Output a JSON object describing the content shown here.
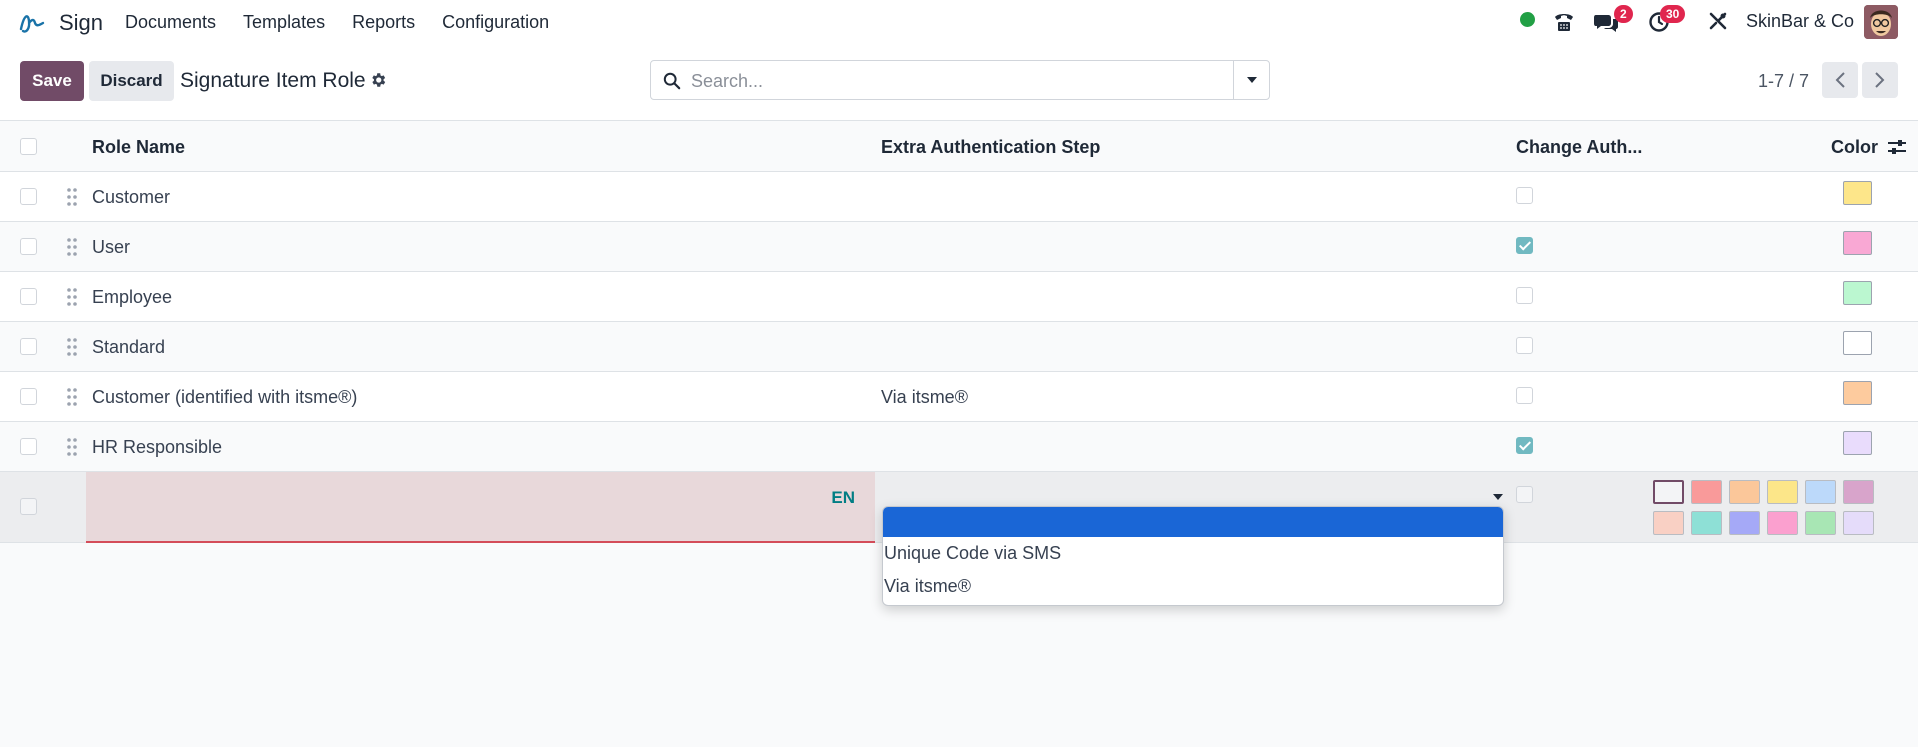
{
  "app": {
    "name": "Sign"
  },
  "nav": {
    "items": [
      "Documents",
      "Templates",
      "Reports",
      "Configuration"
    ]
  },
  "systray": {
    "messages_count": "2",
    "activities_count": "30",
    "company": "SkinBar & Co"
  },
  "control_panel": {
    "save_label": "Save",
    "discard_label": "Discard",
    "title": "Signature Item Role",
    "search_placeholder": "Search...",
    "pager": "1-7 / 7"
  },
  "table": {
    "columns": {
      "role_name": "Role Name",
      "extra_auth": "Extra Authentication Step",
      "change_auth": "Change Auth...",
      "color": "Color"
    },
    "rows": [
      {
        "name": "Customer",
        "auth": "",
        "change_auth": false,
        "color": "#fde68a"
      },
      {
        "name": "User",
        "auth": "",
        "change_auth": true,
        "color": "#f9a8d4"
      },
      {
        "name": "Employee",
        "auth": "",
        "change_auth": false,
        "color": "#bbf7d0"
      },
      {
        "name": "Standard",
        "auth": "",
        "change_auth": false,
        "color": "#ffffff"
      },
      {
        "name": "Customer (identified with itsme®)",
        "auth": "Via itsme®",
        "change_auth": false,
        "color": "#fdcb9e"
      },
      {
        "name": "HR Responsible",
        "auth": "",
        "change_auth": true,
        "color": "#e9dcfc"
      }
    ],
    "edit_row": {
      "lang": "EN"
    }
  },
  "palette_colors": [
    "#f3f4f6",
    "#f99a9a",
    "#fbc79a",
    "#fce689",
    "#bcd9fa",
    "#d8a4cb",
    "#f9d0c4",
    "#8ee0d6",
    "#a5a9f7",
    "#fba0cf",
    "#a8e6b4",
    "#e5dcfa"
  ],
  "dropdown": {
    "options": [
      "",
      "Unique Code via SMS",
      "Via itsme®"
    ]
  }
}
